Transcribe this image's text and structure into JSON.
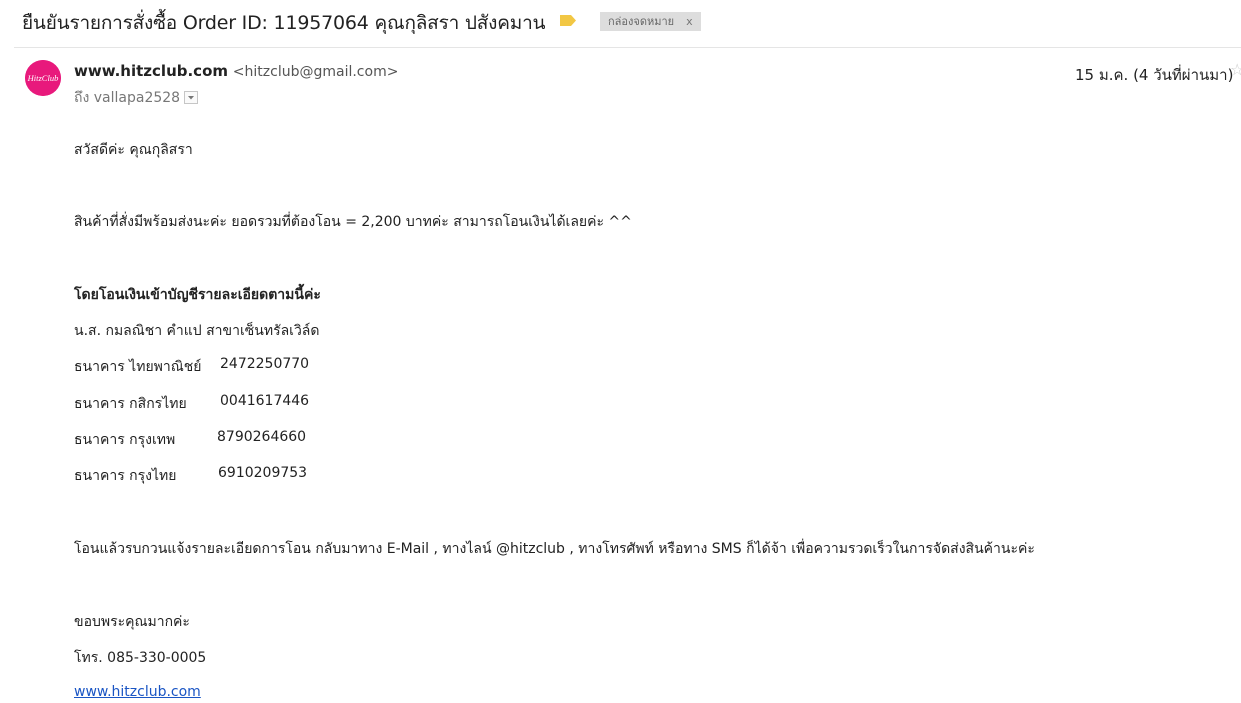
{
  "subject": "ยืนยันรายการสั่งซื้อ Order ID: 11957064 คุณกุลิสรา ปสังคมาน",
  "label_chip": {
    "text": "กล่องจดหมาย",
    "close": "x"
  },
  "colors": {
    "label_arrow": "#f2c744",
    "avatar_bg": "#e8197c",
    "link": "#1a55c4"
  },
  "avatar": {
    "logo_text": "HitzClub"
  },
  "sender": {
    "name": "www.hitzclub.com",
    "email": "<hitzclub@gmail.com>"
  },
  "recipient": {
    "text": "ถึง vallapa2528"
  },
  "date": "15 ม.ค. (4 วันที่ผ่านมา)",
  "star_icon": "☆",
  "body": {
    "greeting": "สวัสดีค่ะ คุณกุลิสรา",
    "message": "สินค้าที่สั่งมีพร้อมส่งนะค่ะ ยอดรวมที่ต้องโอน = 2,200 บาทค่ะ สามารถโอนเงินได้เลยค่ะ ^^",
    "transfer_header": "โดยโอนเงินเข้าบัญชีรายละเอียดตามนี้ค่ะ",
    "account_holder": "น.ส. กมลณิชา คำแป สาขาเซ็นทรัลเวิล์ด",
    "banks": [
      {
        "name": "ธนาคาร ไทยพาณิชย์",
        "account": "2472250770"
      },
      {
        "name": "ธนาคาร กสิกรไทย",
        "account": "0041617446"
      },
      {
        "name": "ธนาคาร กรุงเทพ",
        "account": "8790264660"
      },
      {
        "name": "ธนาคาร กรุงไทย",
        "account": "6910209753"
      }
    ],
    "notify": "โอนแล้วรบกวนแจ้งรายละเอียดการโอน กลับมาทาง E-Mail , ทางไลน์ @hitzclub  , ทางโทรศัพท์ หรือทาง SMS ก็ได้จ้า เพื่อความรวดเร็วในการจัดส่งสินค้านะค่ะ",
    "thanks": "ขอบพระคุณมากค่ะ",
    "phone": "โทร. 085-330-0005",
    "website": "www.hitzclub.com"
  }
}
